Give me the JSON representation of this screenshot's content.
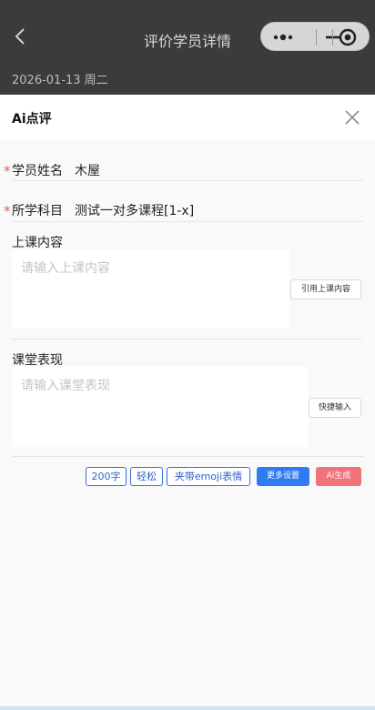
{
  "nav": {
    "title": "评价学员详情",
    "date": "2026-01-13 周二"
  },
  "sheet": {
    "title": "Ai点评",
    "student": {
      "label": "学员姓名",
      "value": "木屋"
    },
    "subject": {
      "label": "所学科目",
      "value": "测试一对多课程[1-x]"
    },
    "lesson": {
      "label": "上课内容",
      "placeholder": "请输入上课内容",
      "side_button": "引用上课内容"
    },
    "performance": {
      "label": "课堂表现",
      "placeholder": "请输入课堂表现",
      "side_button": "快捷输入"
    },
    "options": {
      "length": "200字",
      "tone": "轻松",
      "emoji": "夹带emoji表情",
      "more": "更多设置",
      "generate": "Ai生成"
    },
    "required_mark": "*"
  },
  "colors": {
    "accent_blue": "#2f7af5",
    "generate_red": "#f0737a",
    "required_red": "#e65a4f",
    "tag_blue": "#3b6fd6"
  },
  "icons": {
    "back": "chevron-left-icon",
    "more": "more-dots-icon",
    "minimize": "minimize-icon",
    "target": "target-icon",
    "close": "close-icon"
  }
}
